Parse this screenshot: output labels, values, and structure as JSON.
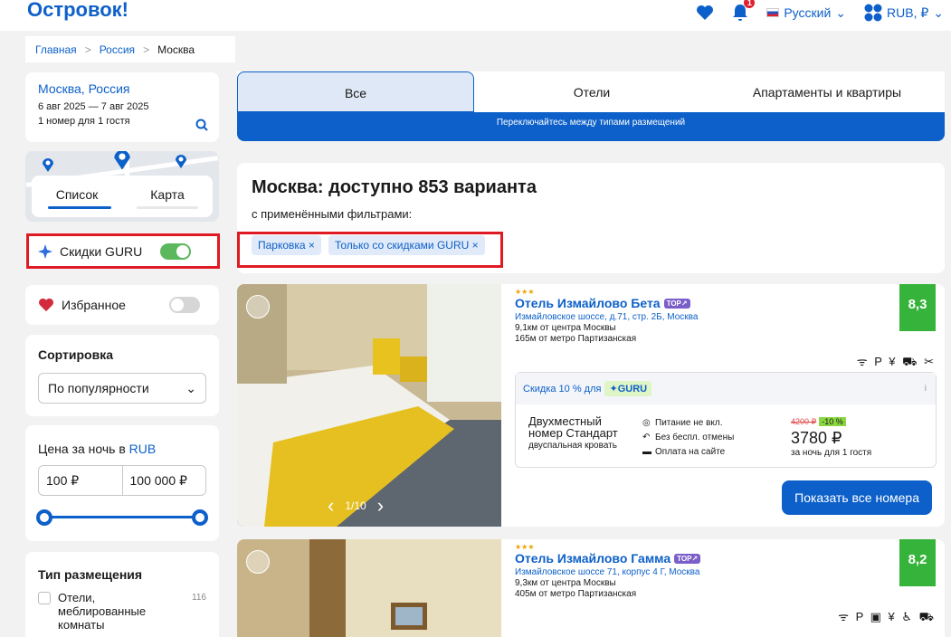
{
  "header": {
    "logo": "Островок!",
    "bell_count": "1",
    "language": "Русский",
    "currency": "RUB, ₽"
  },
  "breadcrumb": {
    "home": "Главная",
    "country": "Россия",
    "city": "Москва"
  },
  "search": {
    "city": "Москва, Россия",
    "dates": "6 авг 2025 — 7 авг 2025",
    "guests": "1 номер для 1 гостя"
  },
  "view_switch": {
    "list": "Список",
    "map": "Карта"
  },
  "filters": {
    "guru_label": "Скидки GURU",
    "guru_on": true,
    "favorites_label": "Избранное",
    "favorites_on": false,
    "sort_title": "Сортировка",
    "sort_value": "По популярности",
    "price_title_prefix": "Цена за ночь в",
    "price_currency": "RUB",
    "price_min": "100 ₽",
    "price_max": "100 000 ₽",
    "type_title": "Тип размещения",
    "type_item_1": "Отели, меблированные комнаты",
    "type_item_1_count": "116"
  },
  "tabs": {
    "all": "Все",
    "hotels": "Отели",
    "apartments": "Апартаменты и квартиры",
    "hint": "Переключайтесь между типами размещений"
  },
  "results": {
    "title": "Москва: доступно 853 варианта",
    "subtitle": "с применёнными фильтрами:",
    "chip_1": "Парковка ×",
    "chip_2": "Только со скидками GURU ×"
  },
  "hotels": [
    {
      "stars": "★★★",
      "name": "Отель Измайлово Бета",
      "badge": "TOP↗",
      "address": "Измайловское шоссе, д.71, стр. 2Б, Москва",
      "center": "9,1км от центра Москвы",
      "metro": "165м от метро Партизанская",
      "score": "8,3",
      "amenities": "ᯤ P ¥ ⛟ ✂",
      "pager": "1/10",
      "discount_text": "Скидка 10 % для",
      "guru": "✦GURU",
      "info": "i",
      "room_name_1": "Двухместный",
      "room_name_2": "номер Стандарт",
      "bed": "двуспальная кровать",
      "cond_meal": "Питание не вкл.",
      "cond_cancel": "Без беспл. отмены",
      "cond_pay": "Оплата на сайте",
      "old_price": "4200 ₽",
      "discount": "-10 %",
      "price": "3780 ₽",
      "per_guest": "за ночь для 1 гостя",
      "button": "Показать все номера"
    },
    {
      "stars": "★★★",
      "name": "Отель Измайлово Гамма",
      "badge": "TOP↗",
      "address": "Измайловское шоссе 71, корпус 4 Г, Москва",
      "center": "9,3км от центра Москвы",
      "metro": "405м от метро Партизанская",
      "score": "8,2",
      "amenities": "ᯤ P ▣ ¥ ♿ ⛟"
    }
  ]
}
